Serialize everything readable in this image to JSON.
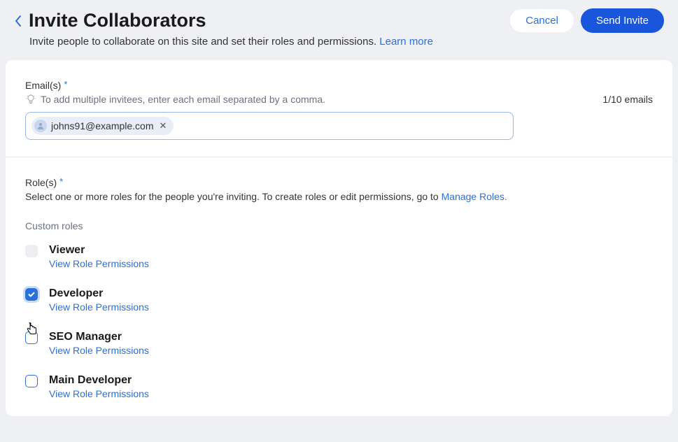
{
  "header": {
    "title": "Invite Collaborators",
    "subtitle_prefix": "Invite people to collaborate on this site and set their roles and permissions. ",
    "learn_more": "Learn more",
    "cancel": "Cancel",
    "send": "Send Invite"
  },
  "emails": {
    "label": "Email(s)",
    "hint": "To add multiple invitees, enter each email separated by a comma.",
    "count": "1/10 emails",
    "chip_value": "johns91@example.com"
  },
  "roles": {
    "label": "Role(s)",
    "help_prefix": "Select one or more roles for the people you're inviting. To create roles or edit permissions, go to ",
    "manage_link": "Manage Roles.",
    "custom_label": "Custom roles",
    "view_permissions": "View Role Permissions",
    "items": [
      {
        "name": "Viewer",
        "checked": false,
        "style": "gray"
      },
      {
        "name": "Developer",
        "checked": true,
        "style": "checked"
      },
      {
        "name": "SEO Manager",
        "checked": false,
        "style": "outline"
      },
      {
        "name": "Main Developer",
        "checked": false,
        "style": "outline"
      }
    ]
  }
}
